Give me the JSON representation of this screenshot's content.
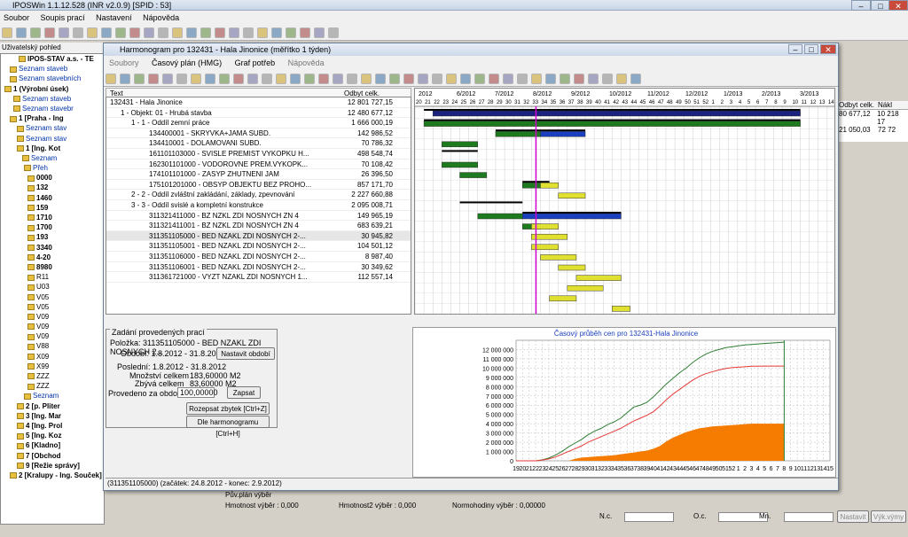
{
  "app": {
    "title": "IPOSWin 1.1.12.528 (INR v2.0.9) [SPID : 53]",
    "menu": [
      "Soubor",
      "Soupis prací",
      "Nastavení",
      "Nápověda"
    ]
  },
  "left": {
    "header": "Uživatelský pohled",
    "items": [
      "IPOS-STAV a.s. - TE",
      "Seznam staveb",
      "Seznam stavebních",
      "1 (Výrobní úsek)",
      "Seznam staveb",
      "Seznam stavebr",
      "1 [Praha - Ing",
      "Seznam stav",
      "Seznam stav",
      "1 [Ing. Kot",
      "Seznam",
      "Přeh",
      "0000",
      "132",
      "1460",
      "159",
      "1710",
      "1700",
      "193",
      "3340",
      "4-20",
      "8980",
      "R11",
      "U03",
      "V05",
      "V05",
      "V09",
      "V09",
      "V09",
      "V88",
      "X09",
      "X99",
      "ZZZ",
      "ZZZ",
      "Seznam",
      "2 [p. Pliter",
      "3 [Ing. Mar",
      "4 [Ing. Prol",
      "5 [Ing. Koz",
      "6 [Kladno]",
      "7 [Obchod",
      "9 [Režie správy]",
      "2 [Kralupy - Ing. Souček]"
    ]
  },
  "window": {
    "title": "Harmonogram pro 132431 - Hala Jinonice  (měřítko 1 týden)",
    "menu": [
      "Soubory",
      "Časový plán (HMG)",
      "Graf potřeb",
      "Nápověda"
    ]
  },
  "grid": {
    "col_text": "Text",
    "col_value": "Odbyt celk.",
    "rows": [
      {
        "label": "132431 - Hala Jinonice",
        "value": "12 801 727,15"
      },
      {
        "label": "1 - Objekt: 01 - Hrubá stavba",
        "value": "12 480 677,12"
      },
      {
        "label": "1 - 1 - Oddíl zemní práce",
        "value": "1 666 000,19"
      },
      {
        "label": "134400001 - SKRYVKA+JAMA SUBD.",
        "value": "142 986,52"
      },
      {
        "label": "134410001 - DOLAMOVANI SUBD.",
        "value": "70 786,32"
      },
      {
        "label": "161101103000 - SVISLE PREMIST VYKOPKU H...",
        "value": "498 548,74"
      },
      {
        "label": "162301101000 - VODOROVNE PREM.VYKOPK...",
        "value": "70 108,42"
      },
      {
        "label": "174101101000 - ZASYP ZHUTNENI JAM",
        "value": "26 396,50"
      },
      {
        "label": "175101201000 - OBSYP OBJEKTU BEZ PROHO...",
        "value": "857 171,70"
      },
      {
        "label": "2 - 2 - Oddíl zvláštní zakládání, základy, zpevnování",
        "value": "2 227 660,88"
      },
      {
        "label": "3 - 3 - Oddíl svislé a kompletní konstrukce",
        "value": "2 095 008,71"
      },
      {
        "label": "311321411000 - BZ NZKL ZDI NOSNYCH ZN 4",
        "value": "149 965,19"
      },
      {
        "label": "311321411001 - BZ NZKL ZDI NOSNYCH ZN 4",
        "value": "683 639,21"
      },
      {
        "label": "311351105000 - BED NZAKL ZDI NOSNYCH 2-...",
        "value": "30 945,82"
      },
      {
        "label": "311351105001 - BED NZAKL ZDI NOSNYCH 2-...",
        "value": "104 501,12"
      },
      {
        "label": "311351106000 - BED NZAKL ZDI NOSNYCH 2-...",
        "value": "8 987,40"
      },
      {
        "label": "311351106001 - BED NZAKL ZDI NOSNYCH 2-...",
        "value": "30 349,62"
      },
      {
        "label": "311361721000 - VYZT NZAKL ZDI NOSNYCH 1...",
        "value": "112 557,14"
      }
    ]
  },
  "gantt": {
    "months": [
      "2012",
      "6/2012",
      "7/2012",
      "8/2012",
      "9/2012",
      "10/2012",
      "11/2012",
      "12/2012",
      "1/2013",
      "2/2013",
      "3/2013"
    ],
    "weeks": "20 21 22 23 24 25 26 27 28 29 30 31 32 33 34 35 36 37 38 39 40 41 42 43 44 45 46 47 48 49 50 51 52 1 2 3 4 5 6 7 8 9 10 11 12 13 14"
  },
  "panel": {
    "title": "Zadání provedených prací",
    "polozka": "Položka: 311351105000 - BED NZAKL ZDI NOSNYCH 2...",
    "obdobi": "Období: 1.8.2012 - 31.8.2012",
    "posledni": "Poslední: 1.8.2012 - 31.8.2012",
    "mnozstvi_label": "Množství celkem",
    "mnozstvi": "183,60000 M2",
    "zbyva_label": "Zbývá celkem",
    "zbyva": "83,60000 M2",
    "provedeno_label": "Provedeno za období",
    "provedeno": "100,00000",
    "btn_nastavit": "Nastavit období",
    "btn_zapsat": "Zapsat",
    "btn_rozepsat": "Rozepsat zbytek [Ctrl+Z]",
    "btn_dle": "Dle harmonogramu [Ctrl+H]"
  },
  "status": "(311351105000)  (začátek: 24.8.2012 - konec: 2.9.2012)",
  "right": {
    "h1": "Odbyt celk.",
    "h2": "Nákl",
    "r1a": "80 677,12",
    "r1b": "10 218 17",
    "r2a": "21 050,03",
    "r2b": "72 72"
  },
  "bottom": {
    "puv": "Pův.plán výběr",
    "hmot": "Hmotnost výběr : 0,000",
    "hmot2": "Hmotnost2 výběr : 0,000",
    "norm": "Normohodiny výběr : 0,00000",
    "nc": "N.c.",
    "oc": "O.c.",
    "mn": "Mn.",
    "nastavit": "Nastavit",
    "vyk": "Výk.výmy"
  },
  "chart_data": {
    "type": "line",
    "title": "Časový průběh cen pro 132431-Hala Jinonice",
    "x": [
      "19",
      "20",
      "21",
      "22",
      "23",
      "24",
      "25",
      "26",
      "27",
      "28",
      "29",
      "30",
      "31",
      "32",
      "33",
      "34",
      "35",
      "36",
      "37",
      "38",
      "39",
      "40",
      "41",
      "42",
      "43",
      "44",
      "45",
      "46",
      "47",
      "48",
      "49",
      "50",
      "51",
      "52",
      "1",
      "2",
      "3",
      "4",
      "5",
      "6",
      "7",
      "8",
      "9",
      "10",
      "11",
      "12",
      "13",
      "14",
      "15"
    ],
    "ylim": [
      0,
      13000000
    ],
    "yticks": [
      "0",
      "1 000 000",
      "2 000 000",
      "3 000 000",
      "4 000 000",
      "5 000 000",
      "6 000 000",
      "7 000 000",
      "8 000 000",
      "9 000 000",
      "10 000 000",
      "11 000 000",
      "12 000 000"
    ],
    "series": [
      {
        "color": "#2e7d32",
        "values": [
          0,
          0,
          0,
          0,
          100000,
          300000,
          600000,
          1000000,
          1500000,
          1900000,
          2300000,
          2800000,
          3200000,
          3500000,
          3900000,
          4200000,
          4600000,
          5200000,
          5800000,
          6000000,
          6300000,
          6900000,
          7600000,
          8300000,
          8900000,
          9500000,
          10000000,
          10600000,
          11100000,
          11500000,
          11800000,
          12000000,
          12200000,
          12300000,
          12400000,
          12500000,
          12550000,
          12600000,
          12650000,
          12700000,
          12750000,
          12800000
        ]
      },
      {
        "color": "#e53935",
        "values": [
          0,
          0,
          0,
          0,
          80000,
          200000,
          400000,
          700000,
          1000000,
          1300000,
          1600000,
          2000000,
          2300000,
          2600000,
          2900000,
          3200000,
          3500000,
          3900000,
          4300000,
          4600000,
          4900000,
          5300000,
          5900000,
          6600000,
          7200000,
          7700000,
          8200000,
          8700000,
          9100000,
          9400000,
          9600000,
          9800000,
          9950000,
          10050000,
          10100000,
          10150000,
          10200000,
          10200000,
          10220000,
          10220000,
          10220000,
          10220000
        ]
      },
      {
        "color": "#f57c00",
        "values": [
          0,
          0,
          0,
          0,
          0,
          0,
          0,
          0,
          0,
          200000,
          350000,
          400000,
          450000,
          500000,
          550000,
          600000,
          700000,
          800000,
          900000,
          1000000,
          1100000,
          1300000,
          1600000,
          2100000,
          2500000,
          2800000,
          3100000,
          3300000,
          3500000,
          3600000,
          3700000,
          3750000,
          3800000,
          3850000,
          3900000,
          3950000,
          4000000,
          4000000,
          4000000,
          4000000,
          4000000,
          4000000
        ]
      }
    ]
  }
}
